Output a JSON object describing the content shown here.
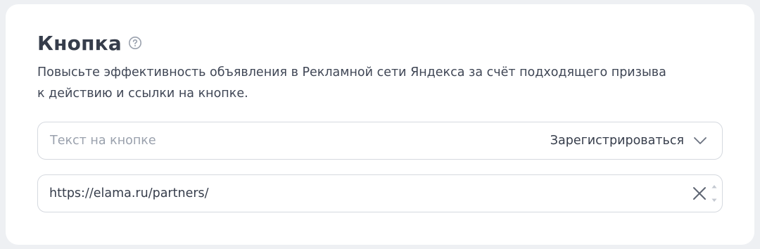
{
  "section": {
    "title": "Кнопка",
    "help_icon": "question-circle-icon",
    "description_line1": "Повысьте эффективность объявления в Рекламной сети Яндекса за счёт подходящего призыва",
    "description_line2": "к действию и ссылки на кнопке."
  },
  "button_text_select": {
    "label": "Текст на кнопке",
    "selected_value": "Зарегистрироваться",
    "icon": "chevron-down-icon"
  },
  "url_field": {
    "value": "https://elama.ru/partners/",
    "clear_icon": "close-icon",
    "spinner_icons": [
      "caret-up-icon",
      "caret-down-icon"
    ]
  },
  "colors": {
    "background": "#eef0f3",
    "card": "#ffffff",
    "text_primary": "#363d4b",
    "text_placeholder": "#9aa1ad",
    "border": "#d5d9df"
  }
}
